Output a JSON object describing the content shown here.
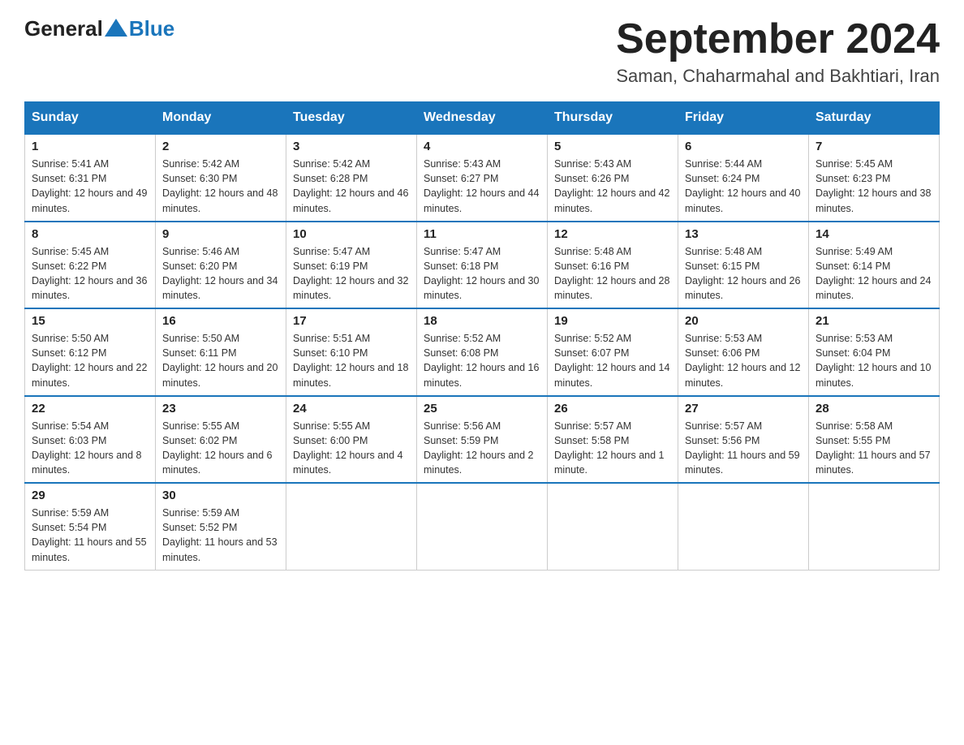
{
  "header": {
    "logo_general": "General",
    "logo_blue": "Blue",
    "title": "September 2024",
    "subtitle": "Saman, Chaharmahal and Bakhtiari, Iran"
  },
  "weekdays": [
    "Sunday",
    "Monday",
    "Tuesday",
    "Wednesday",
    "Thursday",
    "Friday",
    "Saturday"
  ],
  "weeks": [
    [
      {
        "day": "1",
        "sunrise": "5:41 AM",
        "sunset": "6:31 PM",
        "daylight": "12 hours and 49 minutes."
      },
      {
        "day": "2",
        "sunrise": "5:42 AM",
        "sunset": "6:30 PM",
        "daylight": "12 hours and 48 minutes."
      },
      {
        "day": "3",
        "sunrise": "5:42 AM",
        "sunset": "6:28 PM",
        "daylight": "12 hours and 46 minutes."
      },
      {
        "day": "4",
        "sunrise": "5:43 AM",
        "sunset": "6:27 PM",
        "daylight": "12 hours and 44 minutes."
      },
      {
        "day": "5",
        "sunrise": "5:43 AM",
        "sunset": "6:26 PM",
        "daylight": "12 hours and 42 minutes."
      },
      {
        "day": "6",
        "sunrise": "5:44 AM",
        "sunset": "6:24 PM",
        "daylight": "12 hours and 40 minutes."
      },
      {
        "day": "7",
        "sunrise": "5:45 AM",
        "sunset": "6:23 PM",
        "daylight": "12 hours and 38 minutes."
      }
    ],
    [
      {
        "day": "8",
        "sunrise": "5:45 AM",
        "sunset": "6:22 PM",
        "daylight": "12 hours and 36 minutes."
      },
      {
        "day": "9",
        "sunrise": "5:46 AM",
        "sunset": "6:20 PM",
        "daylight": "12 hours and 34 minutes."
      },
      {
        "day": "10",
        "sunrise": "5:47 AM",
        "sunset": "6:19 PM",
        "daylight": "12 hours and 32 minutes."
      },
      {
        "day": "11",
        "sunrise": "5:47 AM",
        "sunset": "6:18 PM",
        "daylight": "12 hours and 30 minutes."
      },
      {
        "day": "12",
        "sunrise": "5:48 AM",
        "sunset": "6:16 PM",
        "daylight": "12 hours and 28 minutes."
      },
      {
        "day": "13",
        "sunrise": "5:48 AM",
        "sunset": "6:15 PM",
        "daylight": "12 hours and 26 minutes."
      },
      {
        "day": "14",
        "sunrise": "5:49 AM",
        "sunset": "6:14 PM",
        "daylight": "12 hours and 24 minutes."
      }
    ],
    [
      {
        "day": "15",
        "sunrise": "5:50 AM",
        "sunset": "6:12 PM",
        "daylight": "12 hours and 22 minutes."
      },
      {
        "day": "16",
        "sunrise": "5:50 AM",
        "sunset": "6:11 PM",
        "daylight": "12 hours and 20 minutes."
      },
      {
        "day": "17",
        "sunrise": "5:51 AM",
        "sunset": "6:10 PM",
        "daylight": "12 hours and 18 minutes."
      },
      {
        "day": "18",
        "sunrise": "5:52 AM",
        "sunset": "6:08 PM",
        "daylight": "12 hours and 16 minutes."
      },
      {
        "day": "19",
        "sunrise": "5:52 AM",
        "sunset": "6:07 PM",
        "daylight": "12 hours and 14 minutes."
      },
      {
        "day": "20",
        "sunrise": "5:53 AM",
        "sunset": "6:06 PM",
        "daylight": "12 hours and 12 minutes."
      },
      {
        "day": "21",
        "sunrise": "5:53 AM",
        "sunset": "6:04 PM",
        "daylight": "12 hours and 10 minutes."
      }
    ],
    [
      {
        "day": "22",
        "sunrise": "5:54 AM",
        "sunset": "6:03 PM",
        "daylight": "12 hours and 8 minutes."
      },
      {
        "day": "23",
        "sunrise": "5:55 AM",
        "sunset": "6:02 PM",
        "daylight": "12 hours and 6 minutes."
      },
      {
        "day": "24",
        "sunrise": "5:55 AM",
        "sunset": "6:00 PM",
        "daylight": "12 hours and 4 minutes."
      },
      {
        "day": "25",
        "sunrise": "5:56 AM",
        "sunset": "5:59 PM",
        "daylight": "12 hours and 2 minutes."
      },
      {
        "day": "26",
        "sunrise": "5:57 AM",
        "sunset": "5:58 PM",
        "daylight": "12 hours and 1 minute."
      },
      {
        "day": "27",
        "sunrise": "5:57 AM",
        "sunset": "5:56 PM",
        "daylight": "11 hours and 59 minutes."
      },
      {
        "day": "28",
        "sunrise": "5:58 AM",
        "sunset": "5:55 PM",
        "daylight": "11 hours and 57 minutes."
      }
    ],
    [
      {
        "day": "29",
        "sunrise": "5:59 AM",
        "sunset": "5:54 PM",
        "daylight": "11 hours and 55 minutes."
      },
      {
        "day": "30",
        "sunrise": "5:59 AM",
        "sunset": "5:52 PM",
        "daylight": "11 hours and 53 minutes."
      },
      null,
      null,
      null,
      null,
      null
    ]
  ]
}
